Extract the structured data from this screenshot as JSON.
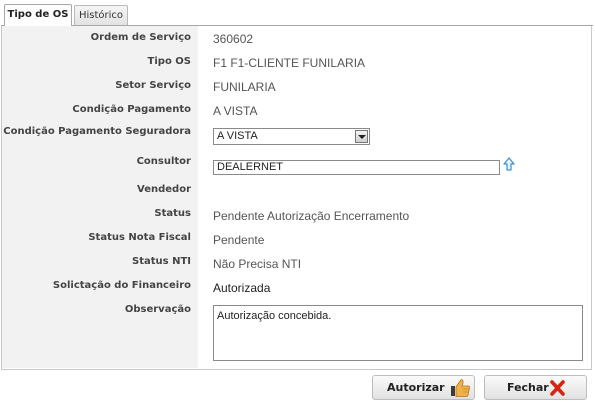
{
  "tabs": [
    {
      "label": "Tipo de OS",
      "active": true
    },
    {
      "label": "Histórico",
      "active": false
    }
  ],
  "form": {
    "ordem_label": "Ordem de Serviço",
    "ordem_value": "360602",
    "tipo_label": "Tipo OS",
    "tipo_value": "F1 F1-CLIENTE FUNILARIA",
    "setor_label": "Setor Serviço",
    "setor_value": "FUNILARIA",
    "condicao_label": "Condição Pagamento",
    "condicao_value": "A VISTA",
    "seguradora_label": "Condição Pagamento Seguradora",
    "seguradora_value": "A VISTA",
    "consultor_label": "Consultor",
    "consultor_value": "DEALERNET",
    "vendedor_label": "Vendedor",
    "vendedor_value": "",
    "status_label": "Status",
    "status_value": "Pendente Autorização Encerramento",
    "status_nf_label": "Status Nota Fiscal",
    "status_nf_value": "Pendente",
    "status_nti_label": "Status NTI",
    "status_nti_value": "Não Precisa NTI",
    "solicitacao_label": "Solictação do Financeiro",
    "solicitacao_value": "Autorizada",
    "observacao_label": "Observação",
    "observacao_value": "Autorização concebida."
  },
  "buttons": {
    "autorizar_label": "Autorizar",
    "fechar_label": "Fechar"
  },
  "icons": {
    "autorizar": "thumbs-up-icon",
    "fechar": "close-icon",
    "consultor_lookup": "up-arrow-icon"
  },
  "colors": {
    "label_bg": "#f2f2f2",
    "close_red": "#d62410",
    "thumb_orange": "#e8a23a",
    "lookup_blue": "#3a8fd8"
  }
}
